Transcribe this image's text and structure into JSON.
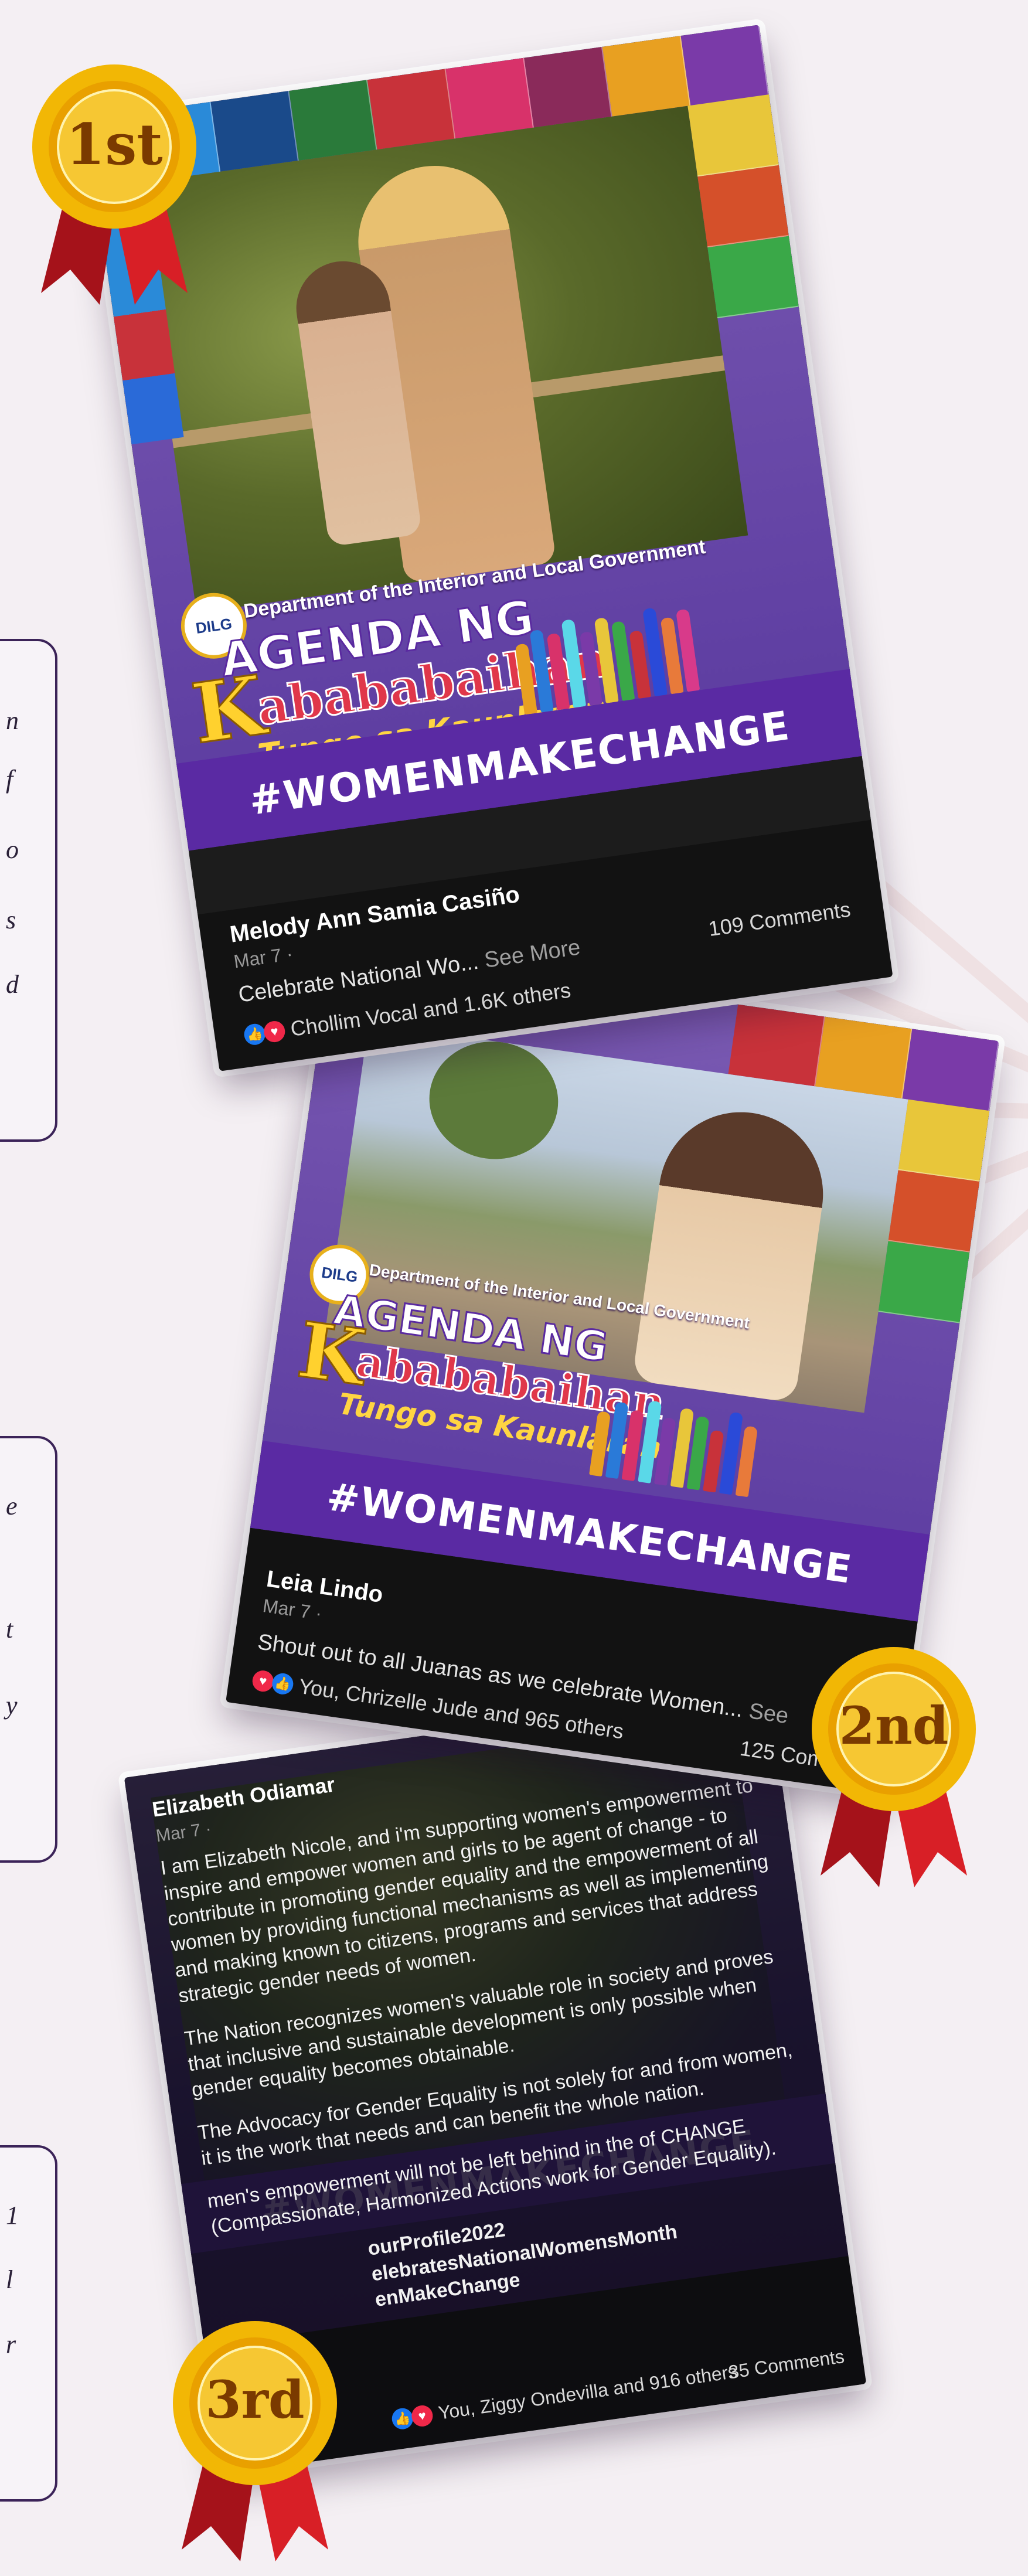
{
  "theme": {
    "background": "#f4eff3",
    "purple": "#5a2aa3",
    "card_dark": "#121212",
    "gold": "#f2b705",
    "ribbon": "#c4161c"
  },
  "side_boxes": [
    {
      "glyphs": [
        "n",
        "f",
        "o",
        "s",
        "d"
      ]
    },
    {
      "glyphs": [
        "e",
        "",
        "t",
        "y"
      ]
    },
    {
      "glyphs": [
        "1",
        "l",
        "r"
      ]
    }
  ],
  "poster": {
    "dept": "Department of the Interior and Local Government",
    "agenda_line1": "AGENDA NG",
    "agenda_k": "K",
    "agenda_line2": "abababaihan",
    "agenda_line3": "Tungo sa Kaunlaran",
    "hashtag": "#WOMENMAKECHANGE",
    "seal": "DILG"
  },
  "medals": [
    {
      "label": "1st",
      "icon": "first-place-medal-icon"
    },
    {
      "label": "2nd",
      "icon": "second-place-medal-icon"
    },
    {
      "label": "3rd",
      "icon": "third-place-medal-icon"
    }
  ],
  "posts": [
    {
      "author": "Melody Ann Samia Casiño",
      "date": "Mar 7 · ",
      "caption": "Celebrate National Wo...",
      "see_more": "See More",
      "reactions": "Chollim Vocal and 1.6K others",
      "comments": "109 Comments"
    },
    {
      "author": "Leia Lindo",
      "date": "Mar 7 · ",
      "caption": "Shout out to all Juanas as we celebrate Women...",
      "see_more": "See",
      "reactions": "You, Chrizelle Jude and 965 others",
      "comments": "125 Comme"
    },
    {
      "author": "Elizabeth Odiamar",
      "date": "Mar 7 · ",
      "paragraphs": [
        "I am Elizabeth Nicole, and i'm supporting women's empowerment to inspire and empower women and girls to be agent of change - to contribute in promoting gender equality and the empowerment of all women by providing functional mechanisms as well as implementing and making known to citizens, programs and services that address strategic gender needs of women.",
        "The Nation recognizes women's valuable role in society and proves that inclusive and sustainable development is only possible when gender equality becomes obtainable.",
        "The Advocacy for Gender Equality is not solely for and from women, it is the work that needs and can benefit the whole nation.",
        "men's empowerment will not be left behind in the of CHANGE (Compassionate, Harmonized Actions work for Gender Equality).",
        "ourProfile2022 elebratesNationalWomensMonth enMakeChange"
      ],
      "reactions": "You, Ziggy Ondevilla and 916 others",
      "comments": "35 Comments"
    }
  ]
}
